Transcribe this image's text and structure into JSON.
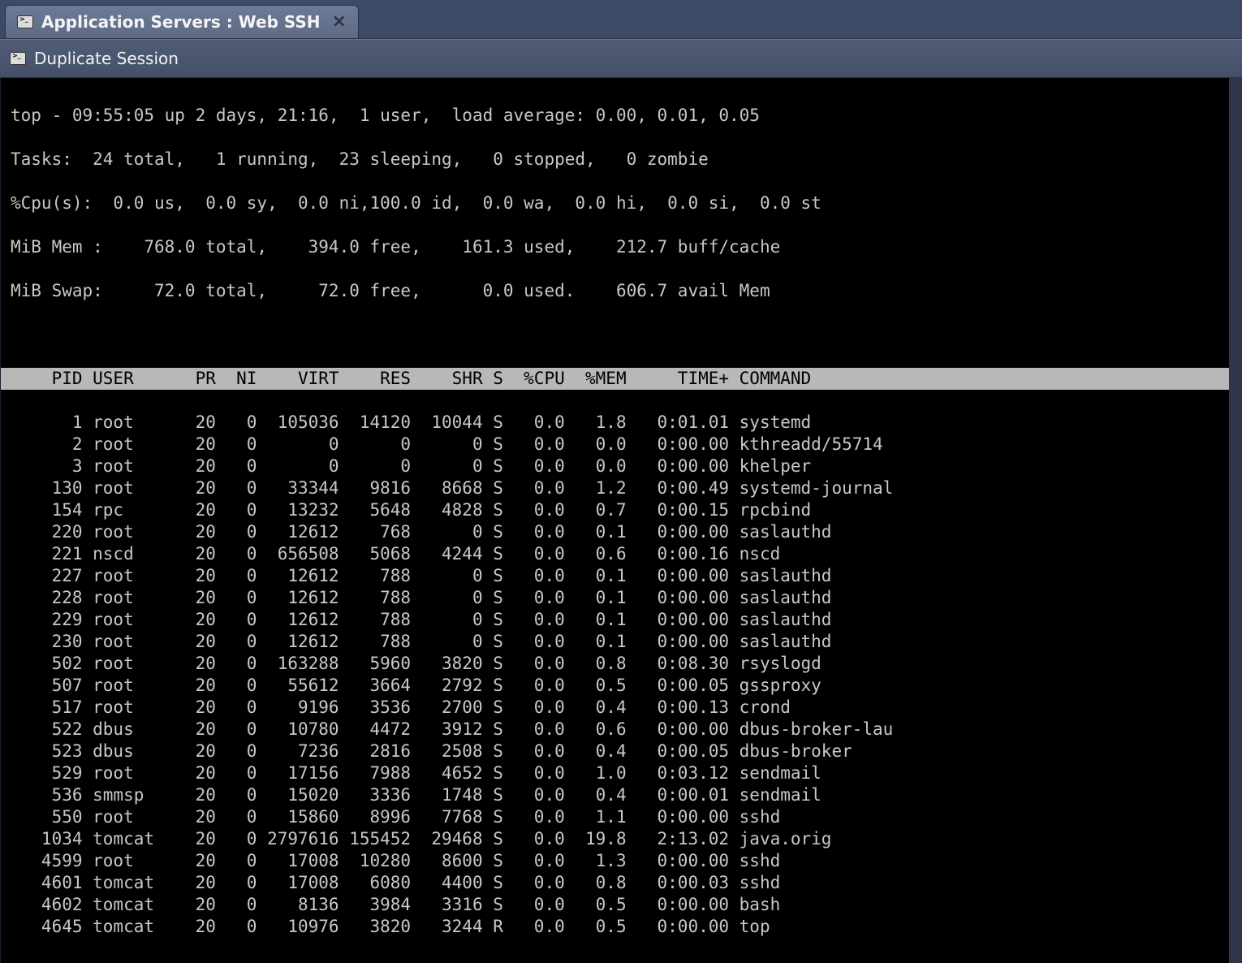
{
  "tab": {
    "title": "Application Servers : Web SSH"
  },
  "toolbar": {
    "duplicate": "Duplicate Session"
  },
  "top": {
    "line1": "top - 09:55:05 up 2 days, 21:16,  1 user,  load average: 0.00, 0.01, 0.05",
    "line2": "Tasks:  24 total,   1 running,  23 sleeping,   0 stopped,   0 zombie",
    "line3": "%Cpu(s):  0.0 us,  0.0 sy,  0.0 ni,100.0 id,  0.0 wa,  0.0 hi,  0.0 si,  0.0 st",
    "line4": "MiB Mem :    768.0 total,    394.0 free,    161.3 used,    212.7 buff/cache",
    "line5": "MiB Swap:     72.0 total,     72.0 free,      0.0 used.    606.7 avail Mem",
    "blank": " ",
    "header": "    PID USER      PR  NI    VIRT    RES    SHR S  %CPU  %MEM     TIME+ COMMAND                                     ",
    "rows": [
      "      1 root      20   0  105036  14120  10044 S   0.0   1.8   0:01.01 systemd",
      "      2 root      20   0       0      0      0 S   0.0   0.0   0:00.00 kthreadd/55714",
      "      3 root      20   0       0      0      0 S   0.0   0.0   0:00.00 khelper",
      "    130 root      20   0   33344   9816   8668 S   0.0   1.2   0:00.49 systemd-journal",
      "    154 rpc       20   0   13232   5648   4828 S   0.0   0.7   0:00.15 rpcbind",
      "    220 root      20   0   12612    768      0 S   0.0   0.1   0:00.00 saslauthd",
      "    221 nscd      20   0  656508   5068   4244 S   0.0   0.6   0:00.16 nscd",
      "    227 root      20   0   12612    788      0 S   0.0   0.1   0:00.00 saslauthd",
      "    228 root      20   0   12612    788      0 S   0.0   0.1   0:00.00 saslauthd",
      "    229 root      20   0   12612    788      0 S   0.0   0.1   0:00.00 saslauthd",
      "    230 root      20   0   12612    788      0 S   0.0   0.1   0:00.00 saslauthd",
      "    502 root      20   0  163288   5960   3820 S   0.0   0.8   0:08.30 rsyslogd",
      "    507 root      20   0   55612   3664   2792 S   0.0   0.5   0:00.05 gssproxy",
      "    517 root      20   0    9196   3536   2700 S   0.0   0.4   0:00.13 crond",
      "    522 dbus      20   0   10780   4472   3912 S   0.0   0.6   0:00.00 dbus-broker-lau",
      "    523 dbus      20   0    7236   2816   2508 S   0.0   0.4   0:00.05 dbus-broker",
      "    529 root      20   0   17156   7988   4652 S   0.0   1.0   0:03.12 sendmail",
      "    536 smmsp     20   0   15020   3336   1748 S   0.0   0.4   0:00.01 sendmail",
      "    550 root      20   0   15860   8996   7768 S   0.0   1.1   0:00.00 sshd",
      "   1034 tomcat    20   0 2797616 155452  29468 S   0.0  19.8   2:13.02 java.orig",
      "   4599 root      20   0   17008  10280   8600 S   0.0   1.3   0:00.00 sshd",
      "   4601 tomcat    20   0   17008   6080   4400 S   0.0   0.8   0:00.03 sshd",
      "   4602 tomcat    20   0    8136   3984   3316 S   0.0   0.5   0:00.00 bash",
      "   4645 tomcat    20   0   10976   3820   3244 R   0.0   0.5   0:00.00 top"
    ]
  }
}
